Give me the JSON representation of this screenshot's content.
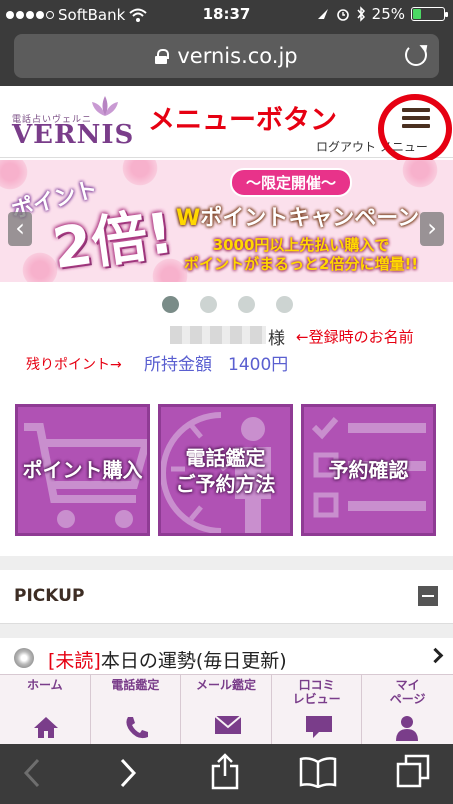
{
  "status_bar": {
    "carrier": "SoftBank",
    "time": "18:37",
    "battery": "25%",
    "battery_level": 0.25
  },
  "browser": {
    "url": "vernis.co.jp"
  },
  "header": {
    "logo_small": "電話占いヴェルニ",
    "logo_main": "VERNIS",
    "annotation": "メニューボタン",
    "links": "ログアウト メニュー"
  },
  "banner": {
    "limited": "〜限定開催〜",
    "point_word": "ポイント",
    "double_word": "2倍!",
    "campaign_w": "W",
    "campaign_text": "ポイントキャンペーン",
    "desc_line1": "3000円以上先払い購入で",
    "desc_line2": "ポイントがまるっと2倍分に増量!!",
    "prev": "‹",
    "next": "›",
    "slides": 4,
    "active_slide": 1
  },
  "user": {
    "sama": "様",
    "name_annotation": "←登録時のお名前",
    "remain_annotation": "残りポイント→",
    "balance_label": "所持金額",
    "balance_value": "1400円"
  },
  "tiles": [
    {
      "label": "ポイント購入",
      "icon": "cart-icon"
    },
    {
      "label_line1": "電話鑑定",
      "label_line2": "ご予約方法",
      "icon": "clock-person-icon"
    },
    {
      "label": "予約確認",
      "icon": "checklist-icon"
    }
  ],
  "pickup": {
    "title": "PICKUP",
    "item_tag": "[未読]",
    "item_text": "本日の運勢(毎日更新)"
  },
  "bottom_nav": [
    {
      "label": "ホーム",
      "icon": "home-icon"
    },
    {
      "label": "電話鑑定",
      "icon": "phone-icon"
    },
    {
      "label": "メール鑑定",
      "icon": "mail-icon"
    },
    {
      "label_line1": "口コミ",
      "label_line2": "レビュー",
      "icon": "chat-icon"
    },
    {
      "label_line1": "マイ",
      "label_line2": "ページ",
      "icon": "person-icon"
    }
  ],
  "colors": {
    "accent": "#b052b4",
    "annotation": "#e60012",
    "balance": "#5a5fd0"
  }
}
